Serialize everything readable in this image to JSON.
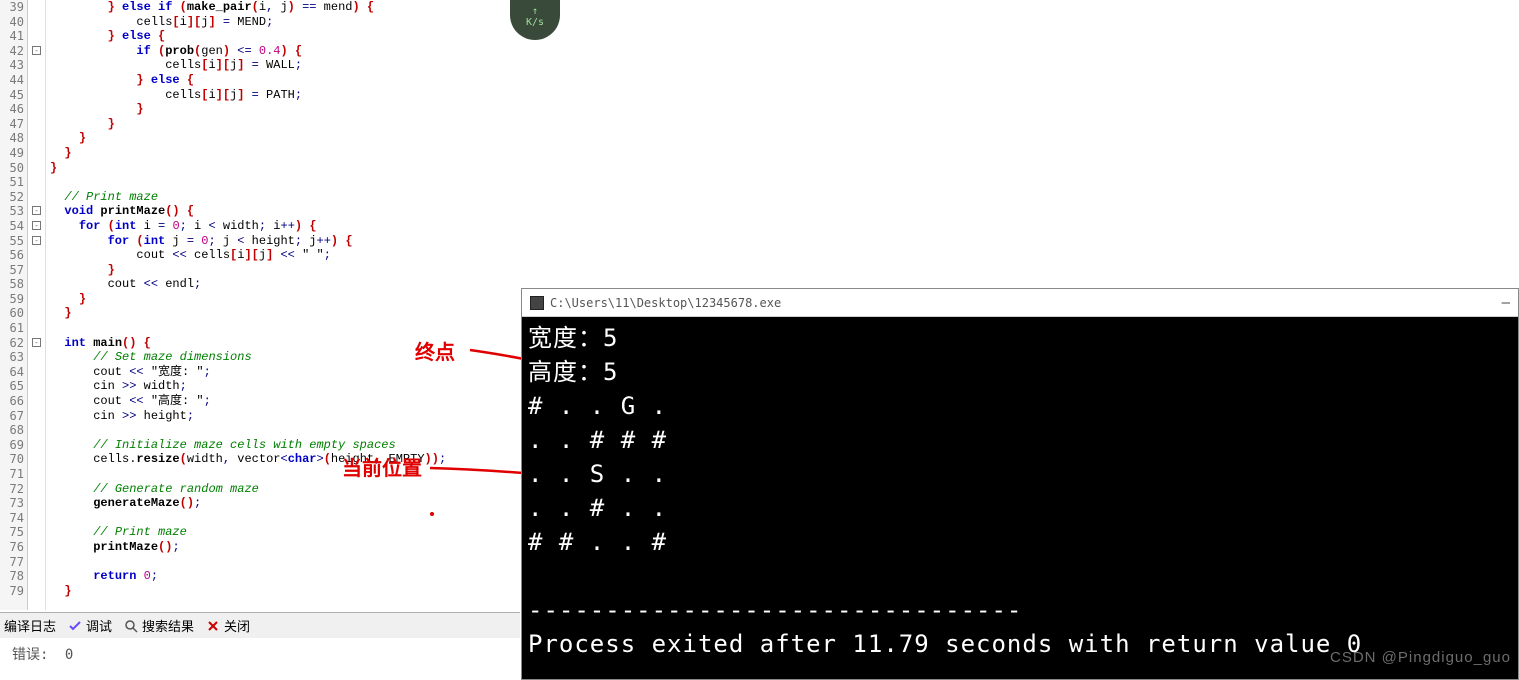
{
  "editor": {
    "startLine": 39,
    "lines": [
      {
        "n": 39,
        "fold": "",
        "html": "        <span class='br'>}</span> <span class='kw'>else if</span> <span class='br'>(</span><span class='fn'>make_pair</span><span class='br'>(</span>i<span class='op'>,</span> j<span class='br'>)</span> <span class='op'>==</span> mend<span class='br'>)</span> <span class='br'>{</span>"
      },
      {
        "n": 40,
        "fold": "",
        "html": "            cells<span class='br'>[</span>i<span class='br'>][</span>j<span class='br'>]</span> <span class='op'>=</span> MEND<span class='op'>;</span>"
      },
      {
        "n": 41,
        "fold": "",
        "html": "        <span class='br'>}</span> <span class='kw'>else</span> <span class='br'>{</span>"
      },
      {
        "n": 42,
        "fold": "box",
        "html": "            <span class='kw'>if</span> <span class='br'>(</span><span class='fn'>prob</span><span class='br'>(</span>gen<span class='br'>)</span> <span class='op'>&lt;=</span> <span class='num'>0.4</span><span class='br'>)</span> <span class='br'>{</span>"
      },
      {
        "n": 43,
        "fold": "",
        "html": "                cells<span class='br'>[</span>i<span class='br'>][</span>j<span class='br'>]</span> <span class='op'>=</span> WALL<span class='op'>;</span>"
      },
      {
        "n": 44,
        "fold": "",
        "html": "            <span class='br'>}</span> <span class='kw'>else</span> <span class='br'>{</span>"
      },
      {
        "n": 45,
        "fold": "",
        "html": "                cells<span class='br'>[</span>i<span class='br'>][</span>j<span class='br'>]</span> <span class='op'>=</span> PATH<span class='op'>;</span>"
      },
      {
        "n": 46,
        "fold": "",
        "html": "            <span class='br'>}</span>"
      },
      {
        "n": 47,
        "fold": "",
        "html": "        <span class='br'>}</span>"
      },
      {
        "n": 48,
        "fold": "",
        "html": "    <span class='br'>}</span>"
      },
      {
        "n": 49,
        "fold": "",
        "html": "  <span class='br'>}</span>"
      },
      {
        "n": 50,
        "fold": "",
        "html": "<span class='br'>}</span>"
      },
      {
        "n": 51,
        "fold": "",
        "html": ""
      },
      {
        "n": 52,
        "fold": "",
        "html": "  <span class='cm'>// Print maze</span>"
      },
      {
        "n": 53,
        "fold": "box",
        "html": "  <span class='kw'>void</span> <span class='fn'>printMaze</span><span class='br'>()</span> <span class='br'>{</span>"
      },
      {
        "n": 54,
        "fold": "box",
        "html": "    <span class='kw'>for</span> <span class='br'>(</span><span class='kw'>int</span> i <span class='op'>=</span> <span class='num'>0</span><span class='op'>;</span> i <span class='op'>&lt;</span> width<span class='op'>;</span> i<span class='op'>++</span><span class='br'>)</span> <span class='br'>{</span>"
      },
      {
        "n": 55,
        "fold": "box",
        "html": "        <span class='kw'>for</span> <span class='br'>(</span><span class='kw'>int</span> j <span class='op'>=</span> <span class='num'>0</span><span class='op'>;</span> j <span class='op'>&lt;</span> height<span class='op'>;</span> j<span class='op'>++</span><span class='br'>)</span> <span class='br'>{</span>"
      },
      {
        "n": 56,
        "fold": "",
        "html": "            cout <span class='op'>&lt;&lt;</span> cells<span class='br'>[</span>i<span class='br'>][</span>j<span class='br'>]</span> <span class='op'>&lt;&lt;</span> <span class='str'>\" \"</span><span class='op'>;</span>"
      },
      {
        "n": 57,
        "fold": "",
        "html": "        <span class='br'>}</span>"
      },
      {
        "n": 58,
        "fold": "",
        "html": "        cout <span class='op'>&lt;&lt;</span> endl<span class='op'>;</span>"
      },
      {
        "n": 59,
        "fold": "",
        "html": "    <span class='br'>}</span>"
      },
      {
        "n": 60,
        "fold": "",
        "html": "  <span class='br'>}</span>"
      },
      {
        "n": 61,
        "fold": "",
        "html": ""
      },
      {
        "n": 62,
        "fold": "box",
        "html": "  <span class='kw'>int</span> <span class='fn'>main</span><span class='br'>()</span> <span class='br'>{</span>"
      },
      {
        "n": 63,
        "fold": "",
        "html": "      <span class='cm'>// Set maze dimensions</span>"
      },
      {
        "n": 64,
        "fold": "",
        "html": "      cout <span class='op'>&lt;&lt;</span> <span class='str'>\"宽度: \"</span><span class='op'>;</span>"
      },
      {
        "n": 65,
        "fold": "",
        "html": "      cin <span class='op'>&gt;&gt;</span> width<span class='op'>;</span>"
      },
      {
        "n": 66,
        "fold": "",
        "html": "      cout <span class='op'>&lt;&lt;</span> <span class='str'>\"高度: \"</span><span class='op'>;</span>"
      },
      {
        "n": 67,
        "fold": "",
        "html": "      cin <span class='op'>&gt;&gt;</span> height<span class='op'>;</span>"
      },
      {
        "n": 68,
        "fold": "",
        "html": ""
      },
      {
        "n": 69,
        "fold": "",
        "html": "      <span class='cm'>// Initialize maze cells with empty spaces</span>"
      },
      {
        "n": 70,
        "fold": "",
        "html": "      cells.<span class='fn'>resize</span><span class='br'>(</span>width<span class='op'>,</span> vector<span class='op'>&lt;</span><span class='kw'>char</span><span class='op'>&gt;</span><span class='br'>(</span>height<span class='op'>,</span> EMPTY<span class='br'>))</span><span class='op'>;</span>"
      },
      {
        "n": 71,
        "fold": "",
        "html": ""
      },
      {
        "n": 72,
        "fold": "",
        "html": "      <span class='cm'>// Generate random maze</span>"
      },
      {
        "n": 73,
        "fold": "",
        "html": "      <span class='fn'>generateMaze</span><span class='br'>()</span><span class='op'>;</span>"
      },
      {
        "n": 74,
        "fold": "",
        "html": ""
      },
      {
        "n": 75,
        "fold": "",
        "html": "      <span class='cm'>// Print maze</span>"
      },
      {
        "n": 76,
        "fold": "",
        "html": "      <span class='fn'>printMaze</span><span class='br'>()</span><span class='op'>;</span>"
      },
      {
        "n": 77,
        "fold": "",
        "html": ""
      },
      {
        "n": 78,
        "fold": "",
        "html": "      <span class='kw'>return</span> <span class='num'>0</span><span class='op'>;</span>"
      },
      {
        "n": 79,
        "fold": "",
        "html": "  <span class='br'>}</span>"
      }
    ]
  },
  "tabs": {
    "compile": "编译日志",
    "debug": "调试",
    "search": "搜索结果",
    "close": "关闭"
  },
  "status": {
    "errors_label": "错误:",
    "errors_count": "0"
  },
  "badge": {
    "up": "↑",
    "rate": "K/s"
  },
  "annotations": {
    "end": "终点",
    "current": "当前位置"
  },
  "console": {
    "title": "C:\\Users\\11\\Desktop\\12345678.exe",
    "lines": [
      "宽度：5",
      "高度：5",
      "# . . G .",
      ". . # # #",
      ". . S . .",
      ". . # . .",
      "# # . . #",
      "",
      "--------------------------------",
      "Process exited after 11.79 seconds with return value 0"
    ]
  },
  "watermark": "CSDN @Pingdiguo_guo"
}
